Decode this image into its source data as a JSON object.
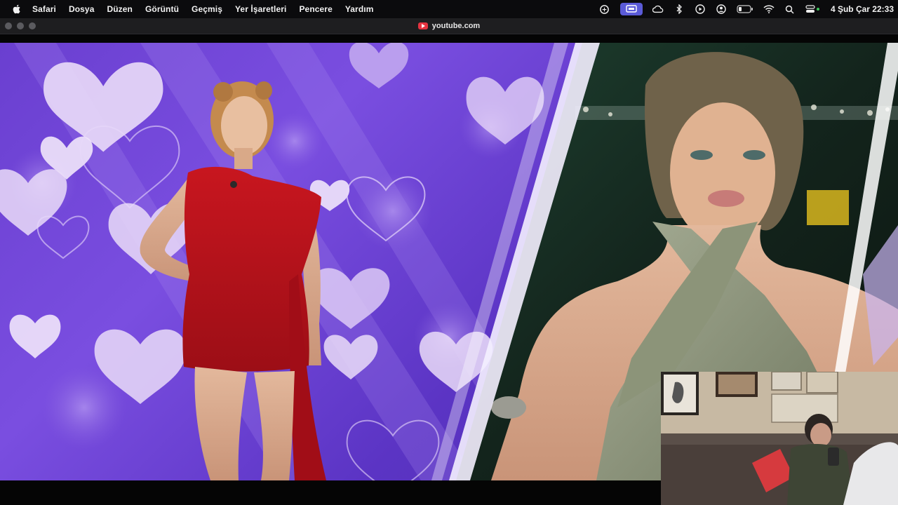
{
  "menubar": {
    "app_name": "Safari",
    "items": [
      "Dosya",
      "Düzen",
      "Görüntü",
      "Geçmiş",
      "Yer İşaretleri",
      "Pencere",
      "Yardım"
    ],
    "clock": "4 Şub Çar  22:33",
    "status_icons": [
      "chatgpt-icon",
      "screen-mirroring-icon",
      "creative-cloud-icon",
      "bluetooth-icon",
      "play-icon",
      "user-icon",
      "battery-icon",
      "wifi-icon",
      "search-icon",
      "control-center-icon"
    ]
  },
  "toolbar": {
    "url": "youtube.com"
  },
  "video": {
    "description_colors": {
      "background": "#6a3fd0",
      "hearts": "#e9d7f7",
      "dress_left": "#c0141e",
      "dress_right": "#8a9478"
    }
  }
}
